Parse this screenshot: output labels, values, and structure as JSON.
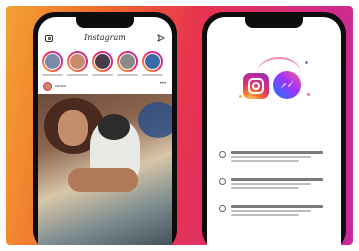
{
  "background": {
    "gradient_colors": [
      "#f3a233",
      "#f06a2b",
      "#e8344f",
      "#d62d77",
      "#c72aa0"
    ]
  },
  "left_phone": {
    "app_title": "Instagram",
    "icons": [
      "camera-icon",
      "direct-message-icon"
    ],
    "story_count": 5,
    "post": {
      "username": "••••••••",
      "more": "•••"
    }
  },
  "right_phone": {
    "intro_title": "",
    "features": [
      {
        "icon": "chat-icon"
      },
      {
        "icon": "reply-icon"
      },
      {
        "icon": "settings-icon"
      }
    ]
  }
}
